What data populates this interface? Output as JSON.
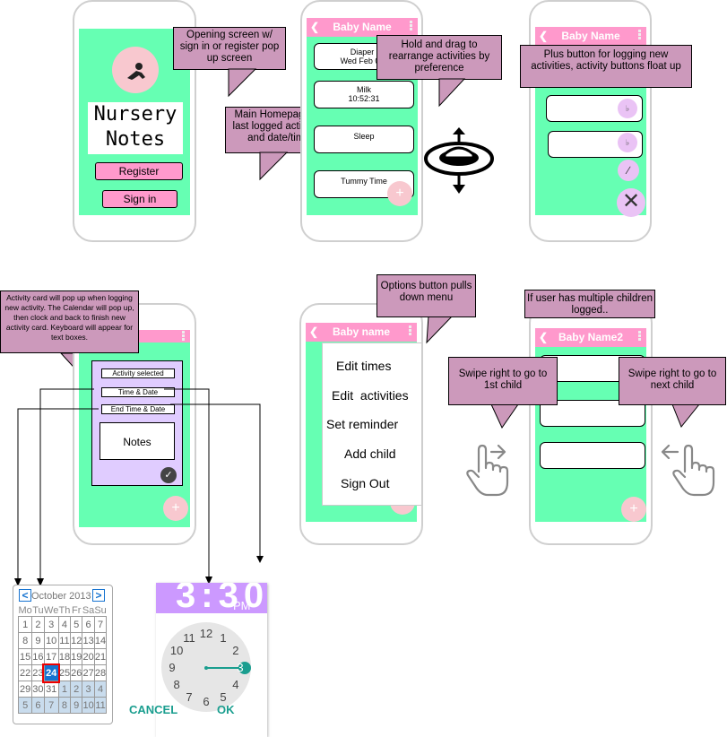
{
  "phone1": {
    "app_title_line1": "Nursery",
    "app_title_line2": "Notes",
    "register_label": "Register",
    "signin_label": "Sign in"
  },
  "notes": {
    "opening": "Opening screen w/ sign in or register pop up screen",
    "main_home": "Main Homepage w/ last logged activities and date/time",
    "hold_drag": "Hold and drag to rearrange activities by preference",
    "plus_button": "Plus button for logging new activities, activity buttons float up",
    "activity_card": "Activity card will pop up when logging new activity. The Calendar will pop up, then clock and back to finish new activity card. Keyboard will appear for text boxes.",
    "options": "Options button pulls down menu",
    "multiple_children": "If user has multiple children logged..",
    "swipe_first": "Swipe right to go to 1st child",
    "swipe_next": "Swipe right to go to next child"
  },
  "phone2": {
    "title": "Baby Name",
    "cards": [
      {
        "line1": "Diaper",
        "line2": "Wed Feb 05"
      },
      {
        "line1": "Milk",
        "line2": "10:52:31"
      },
      {
        "line1": "Sleep",
        "line2": ""
      },
      {
        "line1": "Tummy Time",
        "line2": ""
      }
    ]
  },
  "phone3": {
    "title": "Baby Name"
  },
  "phone4": {
    "fields": [
      "Activity selected",
      "Time & Date",
      "End Time & Date"
    ],
    "notes_label": "Notes"
  },
  "phone5": {
    "title": "Baby name",
    "menu": [
      "Edit times",
      "Edit  activities",
      "Set reminder",
      "Add child",
      "Sign Out"
    ]
  },
  "phone6": {
    "title": "Baby Name2"
  },
  "calendar": {
    "month_label": "October 2013",
    "weekdays": [
      "Mo",
      "Tu",
      "We",
      "Th",
      "Fr",
      "Sa",
      "Su"
    ],
    "weeks": [
      [
        "1",
        "2",
        "3",
        "4",
        "5",
        "6",
        "7"
      ],
      [
        "8",
        "9",
        "10",
        "11",
        "12",
        "13",
        "14"
      ],
      [
        "15",
        "16",
        "17",
        "18",
        "19",
        "20",
        "21"
      ],
      [
        "22",
        "23",
        "24",
        "25",
        "26",
        "27",
        "28"
      ],
      [
        "29",
        "30",
        "31",
        "1",
        "2",
        "3",
        "4"
      ],
      [
        "5",
        "6",
        "7",
        "8",
        "9",
        "10",
        "11"
      ]
    ],
    "selected_day": "24"
  },
  "clock": {
    "time": "3:30",
    "ampm": "PM",
    "numbers": [
      "12",
      "1",
      "2",
      "3",
      "4",
      "5",
      "6",
      "7",
      "8",
      "9",
      "10",
      "11"
    ],
    "cancel_label": "CANCEL",
    "ok_label": "OK"
  },
  "colors": {
    "screen_green": "#66ffb3",
    "header_pink": "#ff99cc",
    "note_purple": "#cc99bb",
    "card_lilac": "#e0ccff",
    "clock_purple": "#cc99ff",
    "teal": "#1a9e8f"
  }
}
